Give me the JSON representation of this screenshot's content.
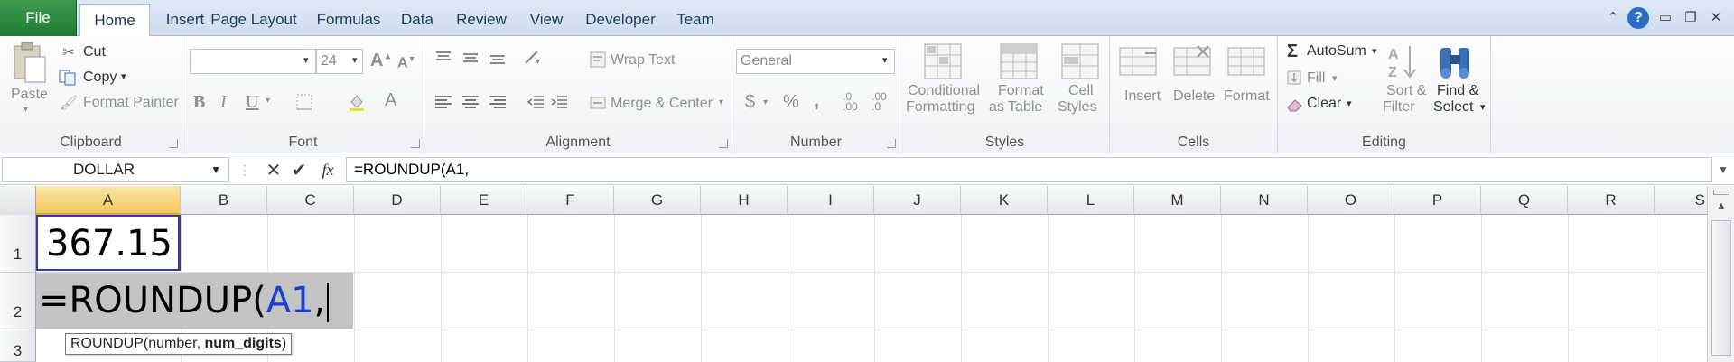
{
  "tabs": {
    "file": "File",
    "items": [
      "Home",
      "Insert",
      "Page Layout",
      "Formulas",
      "Data",
      "Review",
      "View",
      "Developer",
      "Team"
    ]
  },
  "window_icons": [
    "collapse-ribbon-icon",
    "help-icon",
    "minimize-icon",
    "restore-icon",
    "close-icon"
  ],
  "ribbon": {
    "clipboard": {
      "label": "Clipboard",
      "paste": "Paste",
      "cut": "Cut",
      "copy": "Copy",
      "format_painter": "Format Painter"
    },
    "font": {
      "label": "Font",
      "font_name": "",
      "font_size": "24",
      "bold": "B",
      "italic": "I",
      "underline": "U"
    },
    "alignment": {
      "label": "Alignment",
      "wrap_text": "Wrap Text",
      "merge_center": "Merge & Center"
    },
    "number": {
      "label": "Number",
      "format": "General",
      "currency": "$",
      "percent": "%",
      "comma": ","
    },
    "styles": {
      "label": "Styles",
      "conditional_1": "Conditional",
      "conditional_2": "Formatting",
      "format_table_1": "Format",
      "format_table_2": "as Table",
      "cell_styles_1": "Cell",
      "cell_styles_2": "Styles"
    },
    "cells": {
      "label": "Cells",
      "insert": "Insert",
      "delete": "Delete",
      "format": "Format"
    },
    "editing": {
      "label": "Editing",
      "autosum": "AutoSum",
      "fill": "Fill",
      "clear": "Clear",
      "sort_1": "Sort &",
      "sort_2": "Filter",
      "find_1": "Find &",
      "find_2": "Select"
    }
  },
  "formula_bar": {
    "name_box": "DOLLAR",
    "fx": "fx",
    "formula": "=ROUNDUP(A1,"
  },
  "grid": {
    "columns": [
      "A",
      "B",
      "C",
      "D",
      "E",
      "F",
      "G",
      "H",
      "I",
      "J",
      "K",
      "L",
      "M",
      "N",
      "O",
      "P",
      "Q",
      "R",
      "S"
    ],
    "rows": [
      "1",
      "2",
      "3"
    ],
    "a1": "367.15",
    "a2_prefix": "=ROUNDUP(",
    "a2_ref": "A1",
    "a2_suffix": ",",
    "tooltip_func": "ROUNDUP(number, ",
    "tooltip_bold": "num_digits",
    "tooltip_end": ")"
  },
  "colors": {
    "accent_file": "#2a8a40",
    "ref_blue": "#1f3fd0",
    "active_cell_border": "#2f3fa0",
    "edit_cell_bg": "#c4c4c4"
  }
}
